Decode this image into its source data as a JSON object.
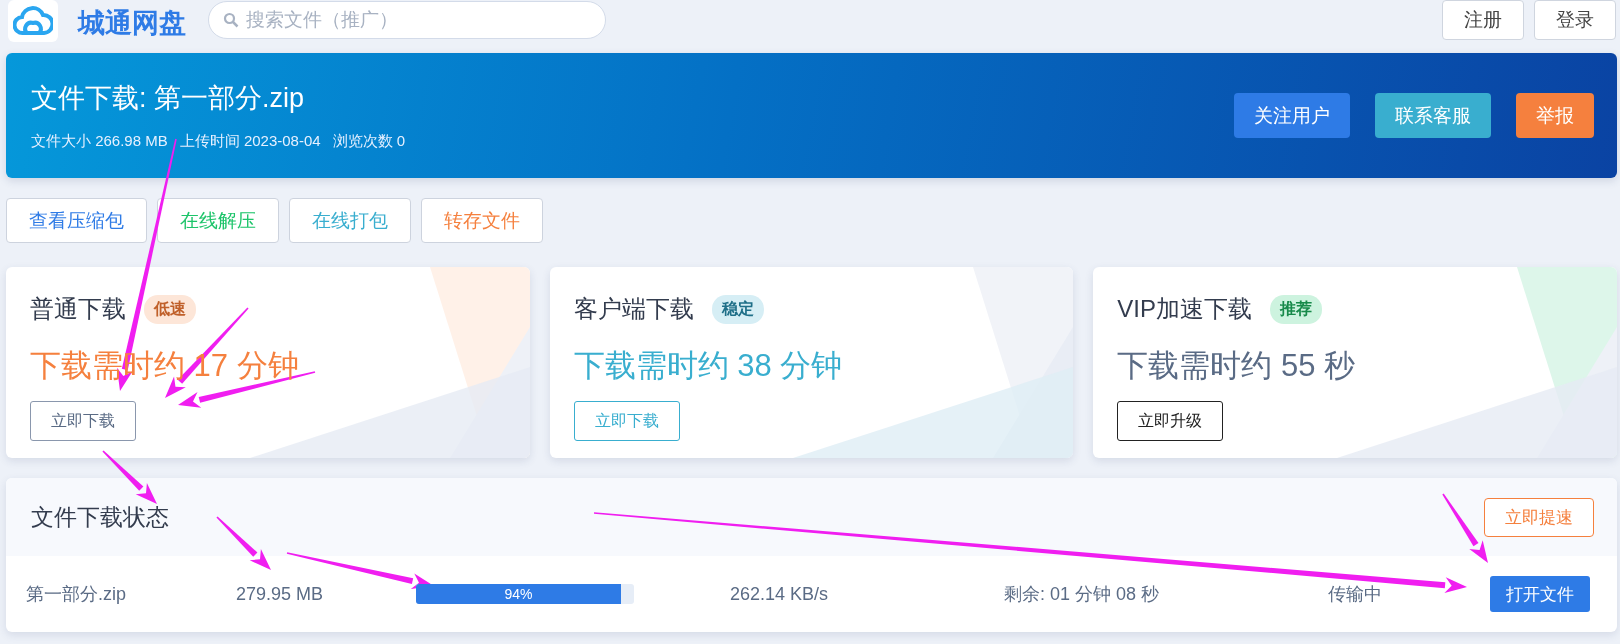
{
  "header": {
    "site_name": "城通网盘",
    "search": {
      "placeholder": "搜索文件（推广）"
    },
    "buttons": [
      "注册",
      "登录"
    ]
  },
  "banner": {
    "title": "文件下载: 第一部分.zip",
    "meta": [
      "文件大小 266.98 MB",
      "上传时间 2023-08-04",
      "浏览次数 0"
    ],
    "buttons": [
      {
        "label": "关注用户",
        "color": "#2e7be6"
      },
      {
        "label": "联系客服",
        "color": "#39aecf"
      },
      {
        "label": "举报",
        "color": "#f5803e"
      }
    ]
  },
  "tools": [
    {
      "label": "查看压缩包",
      "color": "#2e7be6"
    },
    {
      "label": "在线解压",
      "color": "#1dc46a"
    },
    {
      "label": "在线打包",
      "color": "#39aecf"
    },
    {
      "label": "转存文件",
      "color": "#f5803e"
    }
  ],
  "cards": [
    {
      "kind": "normal",
      "title": "普通下载",
      "tag": "低速",
      "estimate": "下载需时约 17 分钟",
      "button": "立即下载"
    },
    {
      "kind": "client",
      "title": "客户端下载",
      "tag": "稳定",
      "estimate": "下载需时约 38 分钟",
      "button": "立即下载"
    },
    {
      "kind": "vip",
      "title": "VIP加速下载",
      "tag": "推荐",
      "estimate": "下载需时约 55 秒",
      "button": "立即升级"
    }
  ],
  "status": {
    "title": "文件下载状态",
    "boost_button": "立即提速",
    "rows": [
      {
        "name": "第一部分.zip",
        "size": "279.95 MB",
        "level": 0.94,
        "progress_label": "94%",
        "speed": "262.14 KB/s",
        "remaining": "剩余: 01 分钟 08 秒",
        "state": "传输中",
        "action": "打开文件"
      }
    ]
  }
}
